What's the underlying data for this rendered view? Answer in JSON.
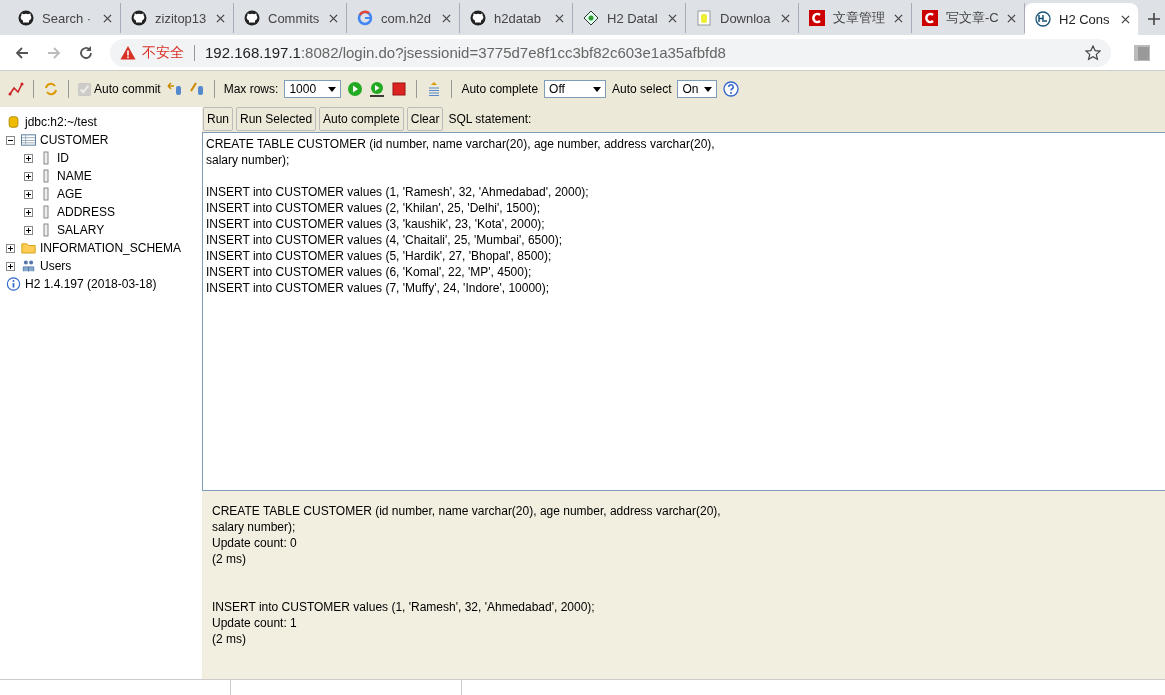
{
  "browser": {
    "tabs": [
      {
        "label": "Search ·",
        "kind": "github",
        "selected": false
      },
      {
        "label": "zizitop13",
        "kind": "github",
        "selected": false
      },
      {
        "label": "Commits",
        "kind": "github",
        "selected": false
      },
      {
        "label": "com.h2d",
        "kind": "google",
        "selected": false
      },
      {
        "label": "h2datab",
        "kind": "github",
        "selected": false
      },
      {
        "label": "H2 Datal",
        "kind": "diamond",
        "selected": false
      },
      {
        "label": "Downloa",
        "kind": "cylinder",
        "selected": false
      },
      {
        "label": "文章管理",
        "kind": "csdn",
        "selected": false
      },
      {
        "label": "写文章-C",
        "kind": "csdn",
        "selected": false
      },
      {
        "label": "H2 Cons",
        "kind": "h2",
        "selected": true
      }
    ],
    "security_label": "不安全",
    "url_host": "192.168.197.1",
    "url_rest": ":8082/login.do?jsessionid=3775d7e8f1cc3bf82c603e1a35afbfd8"
  },
  "toolbar": {
    "auto_commit": {
      "label": "Auto commit",
      "checked": true
    },
    "max_rows": {
      "label": "Max rows:",
      "value": "1000"
    },
    "auto_complete": {
      "label": "Auto complete",
      "value": "Off"
    },
    "auto_select": {
      "label": "Auto select",
      "value": "On"
    }
  },
  "tree": [
    {
      "kind": "database",
      "label": "jdbc:h2:~/test"
    },
    {
      "kind": "table",
      "label": "CUSTOMER",
      "expanded": true,
      "children": [
        {
          "kind": "column",
          "label": "ID",
          "expanded": false
        },
        {
          "kind": "column",
          "label": "NAME",
          "expanded": false
        },
        {
          "kind": "column",
          "label": "AGE",
          "expanded": false
        },
        {
          "kind": "column",
          "label": "ADDRESS",
          "expanded": false
        },
        {
          "kind": "column",
          "label": "SALARY",
          "expanded": false
        }
      ]
    },
    {
      "kind": "folder",
      "label": "INFORMATION_SCHEMA",
      "expanded": false
    },
    {
      "kind": "users",
      "label": "Users",
      "expanded": false
    },
    {
      "kind": "info",
      "label": "H2 1.4.197 (2018-03-18)"
    }
  ],
  "buttons": [
    "Run",
    "Run Selected",
    "Auto complete",
    "Clear"
  ],
  "sql_label": "SQL statement:",
  "sql_blocks": [
    [
      "CREATE TABLE CUSTOMER (id number, name varchar(20), age number, address varchar(20),",
      "salary number);"
    ],
    [
      "INSERT into CUSTOMER values (1, 'Ramesh', 32, 'Ahmedabad', 2000);",
      "INSERT into CUSTOMER values (2, 'Khilan', 25, 'Delhi', 1500);",
      "INSERT into CUSTOMER values (3, 'kaushik', 23, 'Kota', 2000);",
      "INSERT into CUSTOMER values (4, 'Chaitali', 25, 'Mumbai', 6500);",
      "INSERT into CUSTOMER values (5, 'Hardik', 27, 'Bhopal', 8500);",
      "INSERT into CUSTOMER values (6, 'Komal', 22, 'MP', 4500);",
      "INSERT into CUSTOMER values (7, 'Muffy', 24, 'Indore', 10000);"
    ]
  ],
  "results": [
    {
      "statement": [
        "CREATE TABLE CUSTOMER (id number, name varchar(20), age number, address varchar(20),",
        "salary number);"
      ],
      "update_count": "Update count: 0",
      "time": "(2 ms)"
    },
    {
      "statement": [
        "INSERT into CUSTOMER values (1, 'Ramesh', 32, 'Ahmedabad', 2000);"
      ],
      "update_count": "Update count: 1",
      "time": "(2 ms)"
    }
  ]
}
